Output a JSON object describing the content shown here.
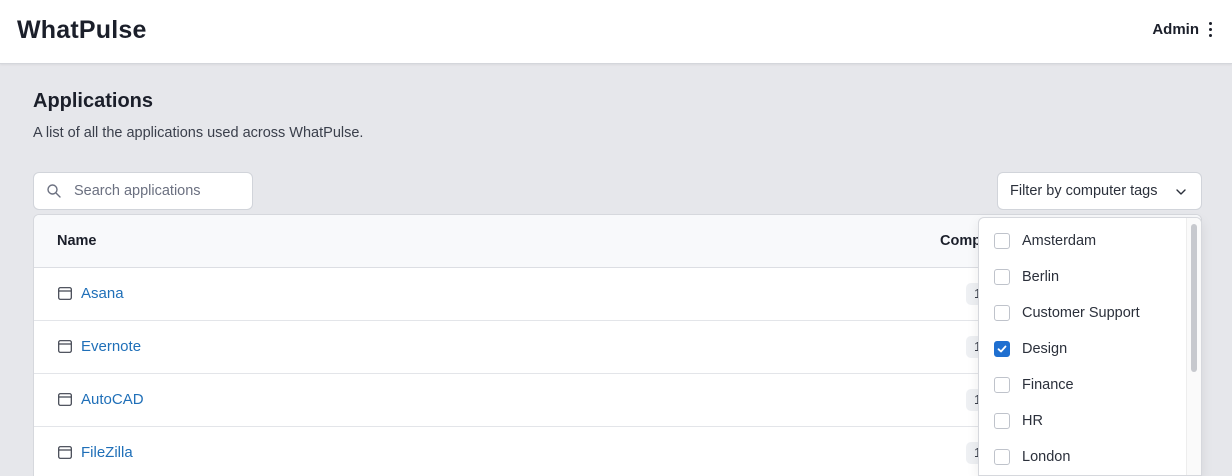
{
  "header": {
    "brand": "WhatPulse",
    "user_menu_label": "Admin"
  },
  "page": {
    "title": "Applications",
    "description": "A list of all the applications used across WhatPulse."
  },
  "search": {
    "placeholder": "Search applications",
    "value": ""
  },
  "filter": {
    "label": "Filter by computer tags"
  },
  "table": {
    "columns": [
      "Name",
      "Comp"
    ],
    "rows": [
      {
        "name": "Asana",
        "count": "1"
      },
      {
        "name": "Evernote",
        "count": "1"
      },
      {
        "name": "AutoCAD",
        "count": "1"
      },
      {
        "name": "FileZilla",
        "count": "1"
      }
    ]
  },
  "tag_options": [
    {
      "label": "Amsterdam",
      "checked": false
    },
    {
      "label": "Berlin",
      "checked": false
    },
    {
      "label": "Customer Support",
      "checked": false
    },
    {
      "label": "Design",
      "checked": true
    },
    {
      "label": "Finance",
      "checked": false
    },
    {
      "label": "HR",
      "checked": false
    },
    {
      "label": "London",
      "checked": false
    }
  ],
  "colors": {
    "link": "#1f6fb8",
    "checkbox_checked": "#1f6fd0",
    "page_bg": "#e6e7eb"
  }
}
